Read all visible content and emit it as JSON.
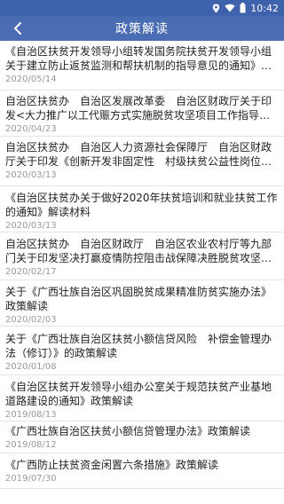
{
  "status_bar": {
    "time": "10:42",
    "icons": [
      "location-icon",
      "wifi-icon",
      "battery-icon"
    ]
  },
  "app_bar": {
    "title": "政策解读",
    "back_icon": "chevron-left-icon"
  },
  "colors": {
    "header": "#4a6cb2",
    "status_bar": "#3f62ac",
    "date_text": "#9a9a9a",
    "divider": "#e4e4e4"
  },
  "articles": [
    {
      "title": "《自治区扶贫开发领导小组转发国务院扶贫开发领导小组关于建立防止返贫监测和帮扶机制的指导意见的通知》的…",
      "date": "2020/05/14"
    },
    {
      "title": "自治区扶贫办　自治区发展改革委　自治区财政厅关于印发<大力推广以工代赈方式实施脱贫攻坚项目工作指导意…",
      "date": "2020/04/23"
    },
    {
      "title": "自治区扶贫办　自治区人力资源社会保障厅　自治区财政厅关于印发《创新开发非固定性　村级扶贫公益性岗位指…",
      "date": "2020/03/13"
    },
    {
      "title": "《自治区扶贫办关于做好2020年扶贫培训和就业扶贫工作的通知》解读材料",
      "date": "2020/03/13"
    },
    {
      "title": "自治区扶贫办　自治区财政厅　自治区农业农村厅等九部门关于印发坚决打赢疫情防控阻击战保障决胜脱贫攻坚若…",
      "date": "2020/02/17"
    },
    {
      "title": "关于《广西壮族自治区巩固脱贫成果精准防贫实施办法》政策解读",
      "date": "2020/02/03"
    },
    {
      "title": "关于《广西壮族自治区扶贫小额信贷风险　补偿金管理办法（修订）》的政策解读",
      "date": "2020/01/08"
    },
    {
      "title": "《自治区扶贫开发领导小组办公室关于规范扶贫产业基地道路建设的通知》政策解读",
      "date": "2019/08/13"
    },
    {
      "title": "《广西壮族自治区扶贫小额信贷管理办法》政策解读",
      "date": "2019/08/12"
    },
    {
      "title": "《广西防止扶贫资金闲置六条措施》政策解读",
      "date": "2019/07/30"
    }
  ]
}
